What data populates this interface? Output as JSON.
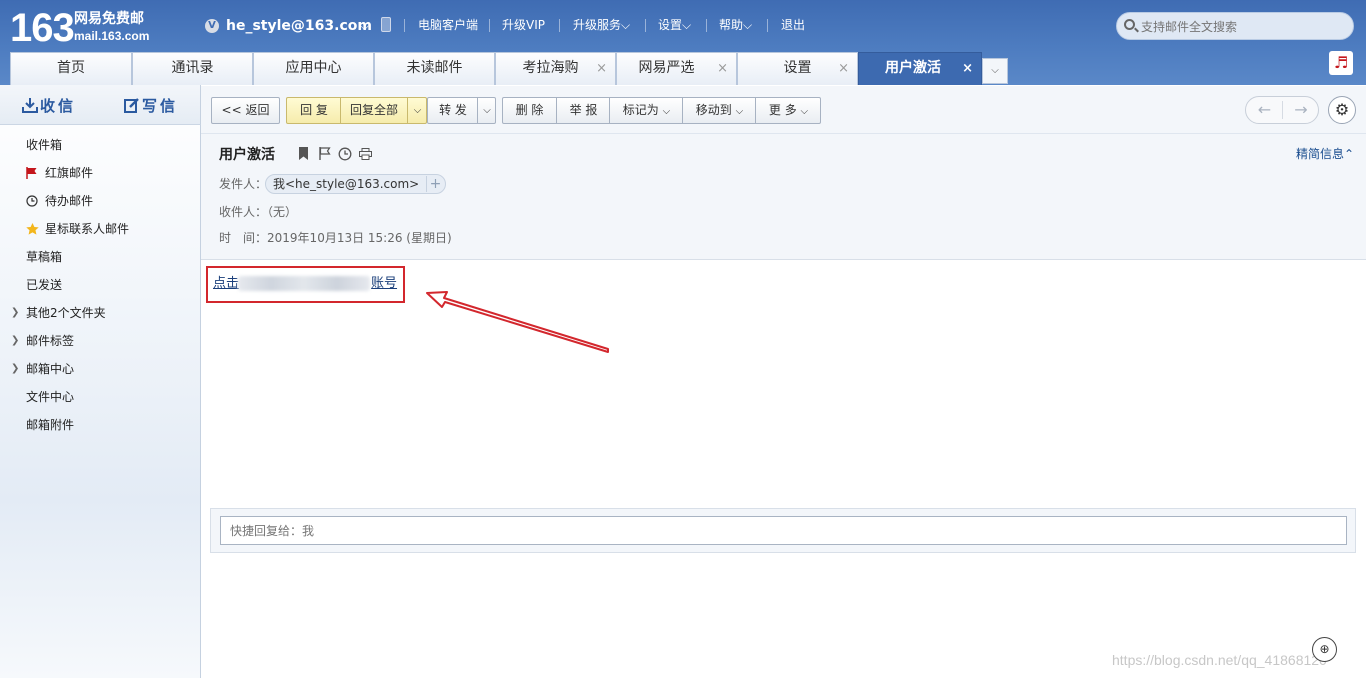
{
  "brand": {
    "number": "163",
    "name": "网易免费邮",
    "domain": "mail.163.com"
  },
  "user": {
    "vip_badge": "V",
    "email": "he_style@163.com",
    "caret": "⌵"
  },
  "top_nav": [
    "电脑客户端",
    "升级VIP",
    "升级服务⌵",
    "设置⌵",
    "帮助⌵",
    "退出"
  ],
  "search": {
    "placeholder": "支持邮件全文搜索"
  },
  "tabs": [
    {
      "label": "首页",
      "closable": false
    },
    {
      "label": "通讯录",
      "closable": false
    },
    {
      "label": "应用中心",
      "closable": false
    },
    {
      "label": "未读邮件",
      "closable": false
    },
    {
      "label": "考拉海购",
      "closable": true
    },
    {
      "label": "网易严选",
      "closable": true
    },
    {
      "label": "设置",
      "closable": true
    },
    {
      "label": "用户激活",
      "closable": true,
      "active": true
    }
  ],
  "tab_close": "×",
  "tab_more": "⌵",
  "music_icon": "♬",
  "sidebar": {
    "receive": "收信",
    "write": "写信",
    "items": [
      {
        "label": "收件箱"
      },
      {
        "label": "红旗邮件",
        "icon": "red-flag-icon"
      },
      {
        "label": "待办邮件",
        "icon": "clock-icon"
      },
      {
        "label": "星标联系人邮件",
        "icon": "star-icon"
      },
      {
        "label": "草稿箱"
      },
      {
        "label": "已发送"
      },
      {
        "label": "其他2个文件夹",
        "expandable": true
      },
      {
        "label": "邮件标签",
        "expandable": true
      },
      {
        "label": "邮箱中心",
        "expandable": true
      },
      {
        "label": "文件中心"
      },
      {
        "label": "邮箱附件"
      }
    ]
  },
  "toolbar": {
    "back": "<< 返回",
    "reply": "回 复",
    "reply_all": "回复全部",
    "forward": "转 发",
    "delete": "删 除",
    "report": "举 报",
    "mark_as": "标记为",
    "move_to": "移动到",
    "more": "更 多",
    "dropdown": "⌵",
    "prev": "←",
    "next": "→",
    "settings": "⚙"
  },
  "mail": {
    "subject": "用户激活",
    "summary_toggle": "精简信息⌃",
    "from_label": "发件人：",
    "from_value": "我<he_style@163.com>",
    "from_add": "+",
    "to_label": "收件人：",
    "to_value": "（无）",
    "time_label": "时　间：",
    "time_value": "2019年10月13日 15:26 (星期日)",
    "body_link_start": "点击",
    "body_link_end": "账号"
  },
  "quick_reply": {
    "placeholder": "快捷回复给：我"
  },
  "zoom_icon": "⊕",
  "watermark": "https://blog.csdn.net/qq_41868120",
  "colors": {
    "header_blue": "#4d7cc0",
    "active_tab": "#3d6ab0",
    "annotation_red": "#d3272d",
    "link": "#1a3e7a"
  }
}
